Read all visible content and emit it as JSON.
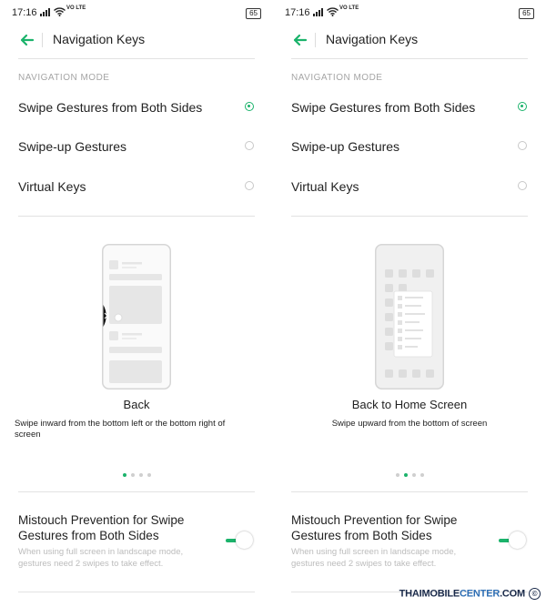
{
  "screens": [
    {
      "status": {
        "time": "17:16",
        "volte": "VO LTE",
        "battery": "65"
      },
      "header": {
        "title": "Navigation Keys"
      },
      "section_label": "NAVIGATION MODE",
      "options": [
        {
          "label": "Swipe Gestures from Both Sides",
          "selected": true
        },
        {
          "label": "Swipe-up Gestures",
          "selected": false
        },
        {
          "label": "Virtual Keys",
          "selected": false
        }
      ],
      "illustration": "side-swipe-back-illustration",
      "caption": {
        "title": "Back",
        "description": "Swipe inward from the bottom left or the bottom right of screen"
      },
      "pager": {
        "total": 4,
        "active": 1
      },
      "mistouch": {
        "title": "Mistouch Prevention for Swipe Gestures from Both Sides",
        "description": "When using full screen in landscape mode, gestures need 2 swipes to take effect.",
        "enabled": true
      }
    },
    {
      "status": {
        "time": "17:16",
        "volte": "VO LTE",
        "battery": "65"
      },
      "header": {
        "title": "Navigation Keys"
      },
      "section_label": "NAVIGATION MODE",
      "options": [
        {
          "label": "Swipe Gestures from Both Sides",
          "selected": true
        },
        {
          "label": "Swipe-up Gestures",
          "selected": false
        },
        {
          "label": "Virtual Keys",
          "selected": false
        }
      ],
      "illustration": "swipe-up-home-illustration",
      "caption": {
        "title": "Back to Home Screen",
        "description": "Swipe upward from the bottom of screen"
      },
      "pager": {
        "total": 4,
        "active": 2
      },
      "mistouch": {
        "title": "Mistouch Prevention for Swipe Gestures from Both Sides",
        "description": "When using full screen in landscape mode, gestures need 2 swipes to take effect.",
        "enabled": true
      }
    }
  ],
  "watermark": {
    "text_main": "THAIMOBILE",
    "text_accent": "CENTER",
    "text_suffix": ".COM",
    "symbol": "©"
  },
  "colors": {
    "accent": "#1bb36b",
    "text": "#222222",
    "muted": "#a5a5a5",
    "divider": "#e2e2e2"
  }
}
